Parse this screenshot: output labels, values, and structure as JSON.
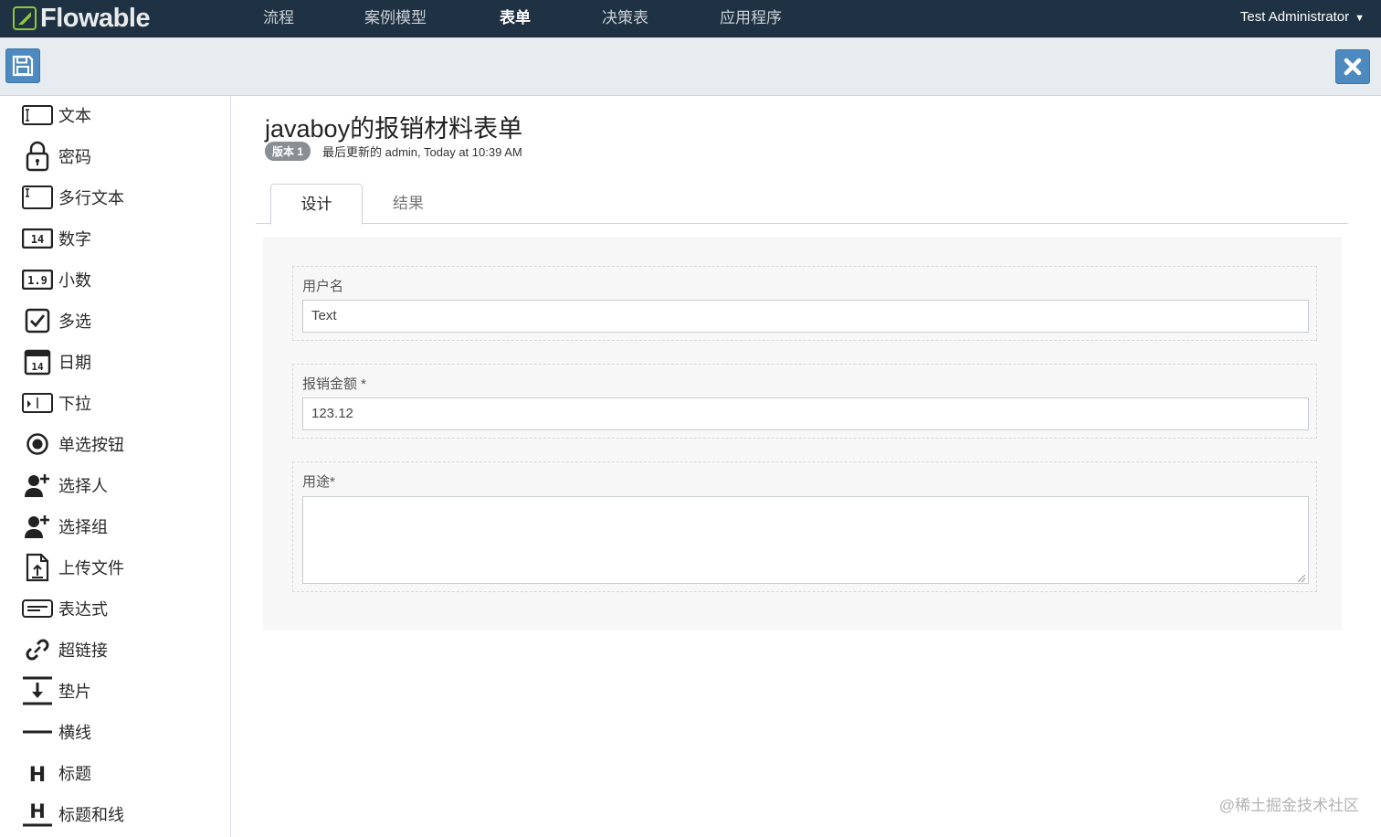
{
  "app": {
    "logo_text": "Flowable"
  },
  "nav": {
    "items": [
      {
        "label": "流程"
      },
      {
        "label": "案例模型"
      },
      {
        "label": "表单",
        "active": true
      },
      {
        "label": "决策表"
      },
      {
        "label": "应用程序"
      }
    ],
    "user": "Test Administrator"
  },
  "toolbar": {
    "save_icon": "save-icon",
    "close_icon": "close-icon",
    "accent": "#4d8ac0"
  },
  "palette": {
    "items": [
      {
        "label": "文本",
        "icon": "text-field-icon"
      },
      {
        "label": "密码",
        "icon": "lock-icon"
      },
      {
        "label": "多行文本",
        "icon": "multiline-text-icon"
      },
      {
        "label": "数字",
        "icon": "number-icon"
      },
      {
        "label": "小数",
        "icon": "decimal-icon"
      },
      {
        "label": "多选",
        "icon": "checkbox-icon"
      },
      {
        "label": "日期",
        "icon": "calendar-icon"
      },
      {
        "label": "下拉",
        "icon": "dropdown-icon"
      },
      {
        "label": "单选按钮",
        "icon": "radio-icon"
      },
      {
        "label": "选择人",
        "icon": "user-add-icon"
      },
      {
        "label": "选择组",
        "icon": "group-add-icon"
      },
      {
        "label": "上传文件",
        "icon": "upload-icon"
      },
      {
        "label": "表达式",
        "icon": "expression-icon"
      },
      {
        "label": "超链接",
        "icon": "link-icon"
      },
      {
        "label": "垫片",
        "icon": "spacer-icon"
      },
      {
        "label": "横线",
        "icon": "horizontal-line-icon"
      },
      {
        "label": "标题",
        "icon": "heading-icon"
      },
      {
        "label": "标题和线",
        "icon": "heading-line-icon"
      }
    ]
  },
  "form": {
    "title": "javaboy的报销材料表单",
    "version_badge": "版本 1",
    "last_updated": "最后更新的 admin, Today at 10:39 AM",
    "tabs": [
      {
        "label": "设计",
        "active": true
      },
      {
        "label": "结果"
      }
    ],
    "fields": [
      {
        "label": "用户名",
        "value": "Text",
        "type": "text"
      },
      {
        "label": "报销金额 *",
        "value": "123.12",
        "type": "text"
      },
      {
        "label": "用途*",
        "value": "",
        "type": "textarea"
      }
    ]
  },
  "watermark": "@稀土掘金技术社区"
}
